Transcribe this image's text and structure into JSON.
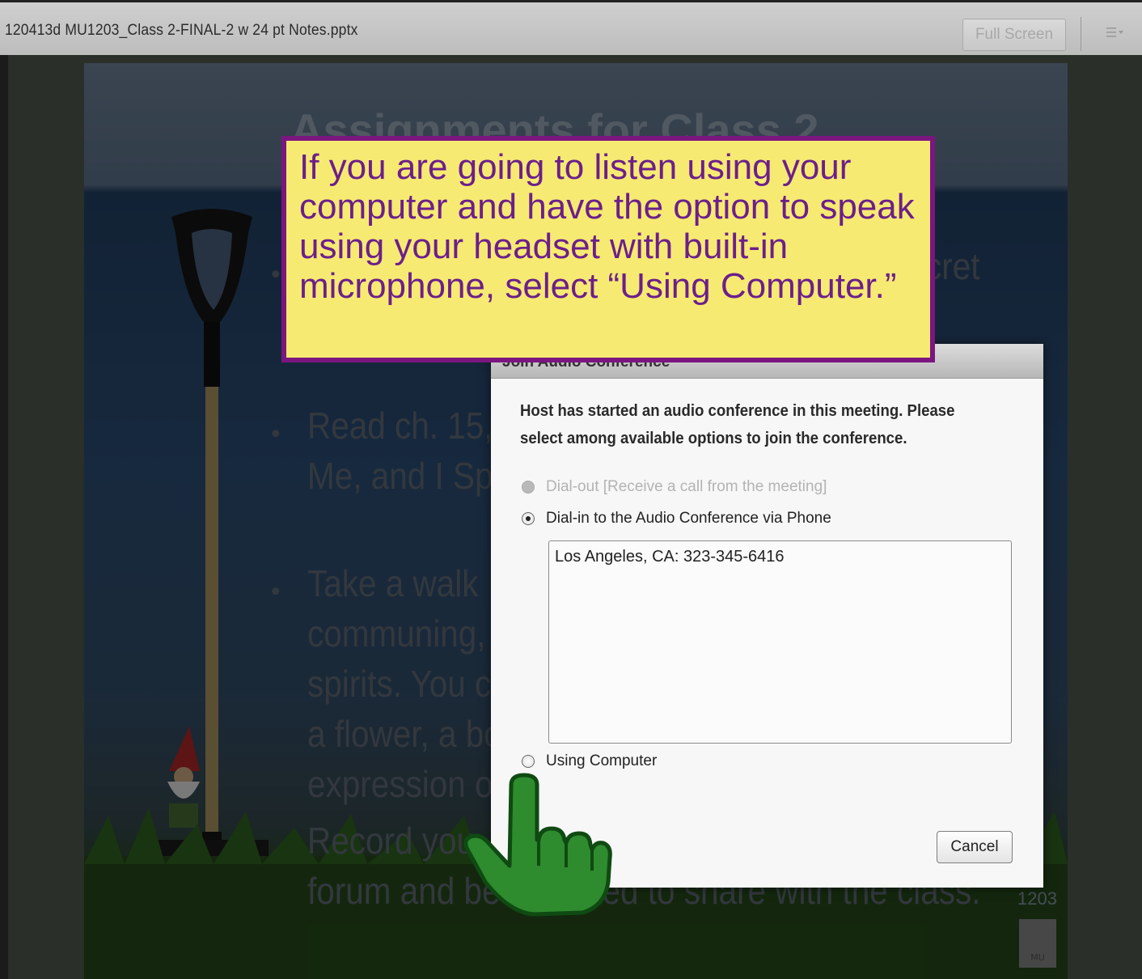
{
  "window": {
    "document_title": "120413d MU1203_Class 2-FINAL-2 w 24 pt Notes.pptx",
    "full_screen_label": "Full Screen",
    "menu_icon": "options-menu-icon"
  },
  "slide": {
    "title": "Assignments for Class 2",
    "bullets": [
      {
        "line1": "",
        "line2": "cret"
      },
      {
        "line1": "Read ch. 15,",
        "line2": "Me, and I Sp"
      },
      {
        "line1": "Take a walk",
        "line2": "communing,",
        "line3": "spirits. You c",
        "line4": "a flower, a bo",
        "line5": "expression o"
      }
    ],
    "record_line1": "Record you",
    "record_line2": "forum and be          red to share with the class.",
    "slide_number": "1203",
    "logo_text": "MU"
  },
  "callout": {
    "text": "If you are going to listen using your computer and have the option to speak using your headset with built-in microphone, select “Using Computer.”"
  },
  "dialog": {
    "title": "Join Audio Conference",
    "message": "Host has started an audio conference in this meeting. Please select among available options to join the conference.",
    "options": [
      {
        "label": "Dial-out [Receive a call from the meeting]",
        "state": "disabled"
      },
      {
        "label": "Dial-in to the Audio Conference via Phone",
        "state": "checked"
      },
      {
        "label": "Using Computer",
        "state": "unchecked"
      }
    ],
    "phone_numbers": "Los Angeles, CA: 323-345-6416",
    "cancel_label": "Cancel"
  },
  "colors": {
    "callout_fill": "#f6ea73",
    "callout_border": "#7b1680",
    "callout_text": "#6c1f8a",
    "pointer_hand": "#2e8b2e"
  }
}
